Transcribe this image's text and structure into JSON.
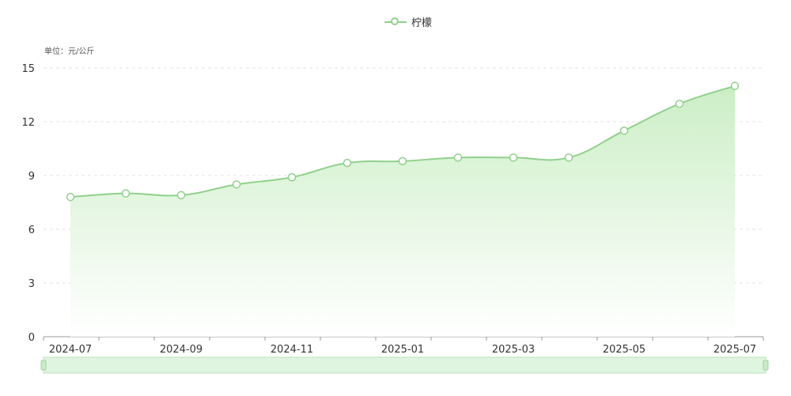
{
  "legend": {
    "series_name": "柠檬"
  },
  "unit_label": "单位：元/公斤",
  "colors": {
    "line": "#8fd18a",
    "area_top": "#c8edc2",
    "area_bottom": "#ffffff",
    "grid": "#e3e3e3",
    "axis": "#999999",
    "zoom_fill": "#dff5e0",
    "zoom_border": "#b9e3b7"
  },
  "chart_data": {
    "type": "area",
    "title": "",
    "series": [
      {
        "name": "柠檬",
        "values": [
          7.8,
          8.0,
          7.9,
          8.5,
          8.9,
          9.7,
          9.8,
          10.0,
          10.0,
          10.0,
          11.5,
          13.0,
          14.0
        ]
      }
    ],
    "x": [
      "2024-07",
      "2024-08",
      "2024-09",
      "2024-10",
      "2024-11",
      "2024-12",
      "2025-01",
      "2025-02",
      "2025-03",
      "2025-04",
      "2025-05",
      "2025-06",
      "2025-07"
    ],
    "x_tick_labels": [
      "2024-07",
      "2024-09",
      "2024-11",
      "2025-01",
      "2025-03",
      "2025-05",
      "2025-07"
    ],
    "y_ticks": [
      0,
      3,
      6,
      9,
      12,
      15
    ],
    "ylim": [
      0,
      15
    ],
    "ylabel": "单位：元/公斤",
    "grid": true,
    "legend_position": "top-center",
    "data_zoom": true
  }
}
